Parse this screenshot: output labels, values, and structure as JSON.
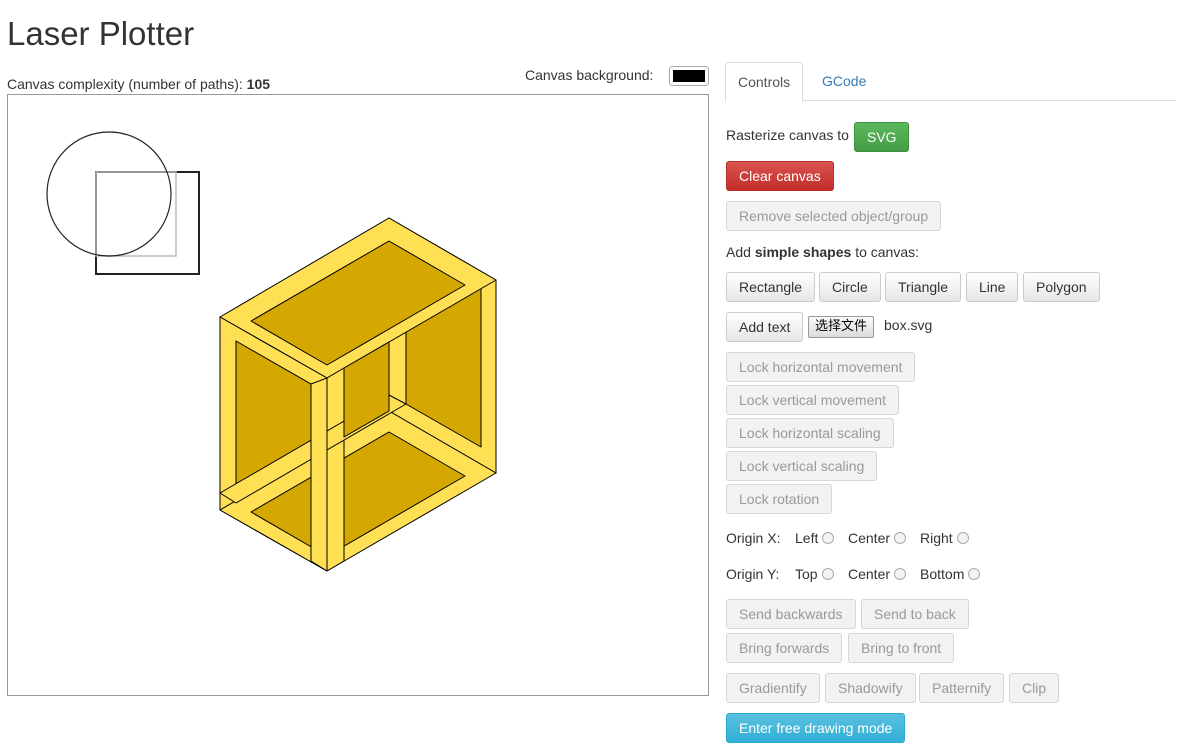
{
  "app": {
    "title": "Laser Plotter"
  },
  "canvas_info": {
    "complexity_label": "Canvas complexity (number of paths):",
    "complexity_value": "105",
    "background_label": "Canvas background:",
    "background_color": "#000000"
  },
  "tabs": [
    {
      "label": "Controls",
      "active": true
    },
    {
      "label": "GCode",
      "active": false
    }
  ],
  "controls": {
    "rasterize_label": "Rasterize canvas to",
    "svg_button": "SVG",
    "clear_button": "Clear canvas",
    "remove_button": "Remove selected object/group",
    "add_shapes_prefix": "Add ",
    "add_shapes_bold": "simple shapes",
    "add_shapes_suffix": " to canvas:",
    "shapes": [
      "Rectangle",
      "Circle",
      "Triangle",
      "Line",
      "Polygon"
    ],
    "add_text_button": "Add text",
    "file_button": "选择文件",
    "file_name": "box.svg",
    "locks": [
      "Lock horizontal movement",
      "Lock vertical movement",
      "Lock horizontal scaling",
      "Lock vertical scaling",
      "Lock rotation"
    ],
    "origin_x": {
      "label": "Origin X:",
      "options": [
        "Left",
        "Center",
        "Right"
      ]
    },
    "origin_y": {
      "label": "Origin Y:",
      "options": [
        "Top",
        "Center",
        "Bottom"
      ]
    },
    "order": [
      "Send backwards",
      "Send to back",
      "Bring forwards",
      "Bring to front"
    ],
    "effects": [
      "Gradientify",
      "Shadowify",
      "Patternify",
      "Clip"
    ],
    "free_draw_button": "Enter free drawing mode"
  },
  "colors": {
    "cube_face": "#ffe055",
    "cube_inner": "#d4a800",
    "success": "#5cb85c",
    "danger": "#d9534f",
    "info": "#5bc0de",
    "link": "#337ab7"
  }
}
